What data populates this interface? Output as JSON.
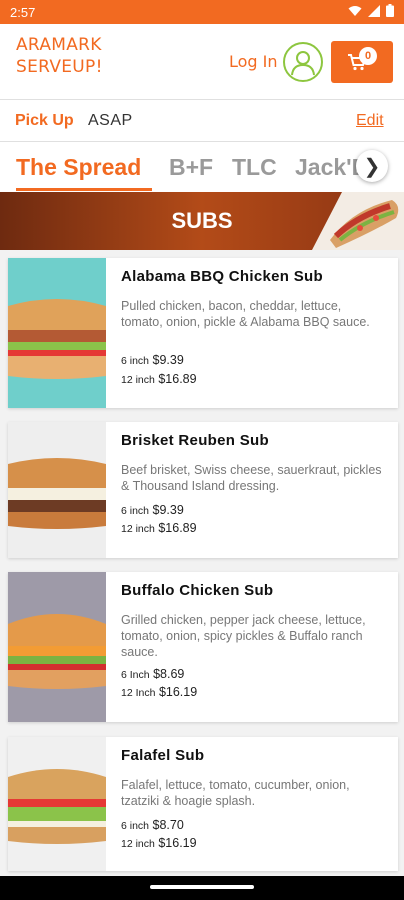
{
  "status_bar": {
    "time": "2:57"
  },
  "header": {
    "brand_line1": "ARAMARK",
    "brand_line2": "SERVEUP!",
    "login_label": "Log In",
    "cart_count": "0"
  },
  "pickup": {
    "label": "Pick Up",
    "value": "ASAP",
    "edit_label": "Edit"
  },
  "tabs": [
    {
      "label": "The Spread"
    },
    {
      "label": "B+F"
    },
    {
      "label": "TLC"
    },
    {
      "label": "Jack'Bu"
    }
  ],
  "banner": {
    "title": "SUBS"
  },
  "items": [
    {
      "name": "Alabama BBQ Chicken Sub",
      "description": "Pulled chicken, bacon, cheddar, lettuce, tomato, onion, pickle & Alabama BBQ sauce.",
      "price1_size": "6 inch",
      "price1": "$9.39",
      "price2_size": "12 inch",
      "price2": "$16.89"
    },
    {
      "name": "Brisket Reuben Sub",
      "description": "Beef brisket, Swiss cheese, sauerkraut, pickles & Thousand Island dressing.",
      "price1_size": "6 inch",
      "price1": "$9.39",
      "price2_size": "12 inch",
      "price2": "$16.89"
    },
    {
      "name": "Buffalo Chicken Sub",
      "description": "Grilled chicken, pepper jack cheese, lettuce, tomato, onion, spicy pickles & Buffalo ranch sauce.",
      "price1_size": "6 Inch",
      "price1": "$8.69",
      "price2_size": "12 Inch",
      "price2": "$16.19"
    },
    {
      "name": "Falafel Sub",
      "description": "Falafel, lettuce, tomato, cucumber, onion, tzatziki & hoagie splash.",
      "price1_size": "6 inch",
      "price1": "$8.70",
      "price2_size": "12 inch",
      "price2": "$16.19"
    }
  ],
  "colors": {
    "accent": "#f26a21",
    "avatar_ring": "#8dc63f"
  }
}
